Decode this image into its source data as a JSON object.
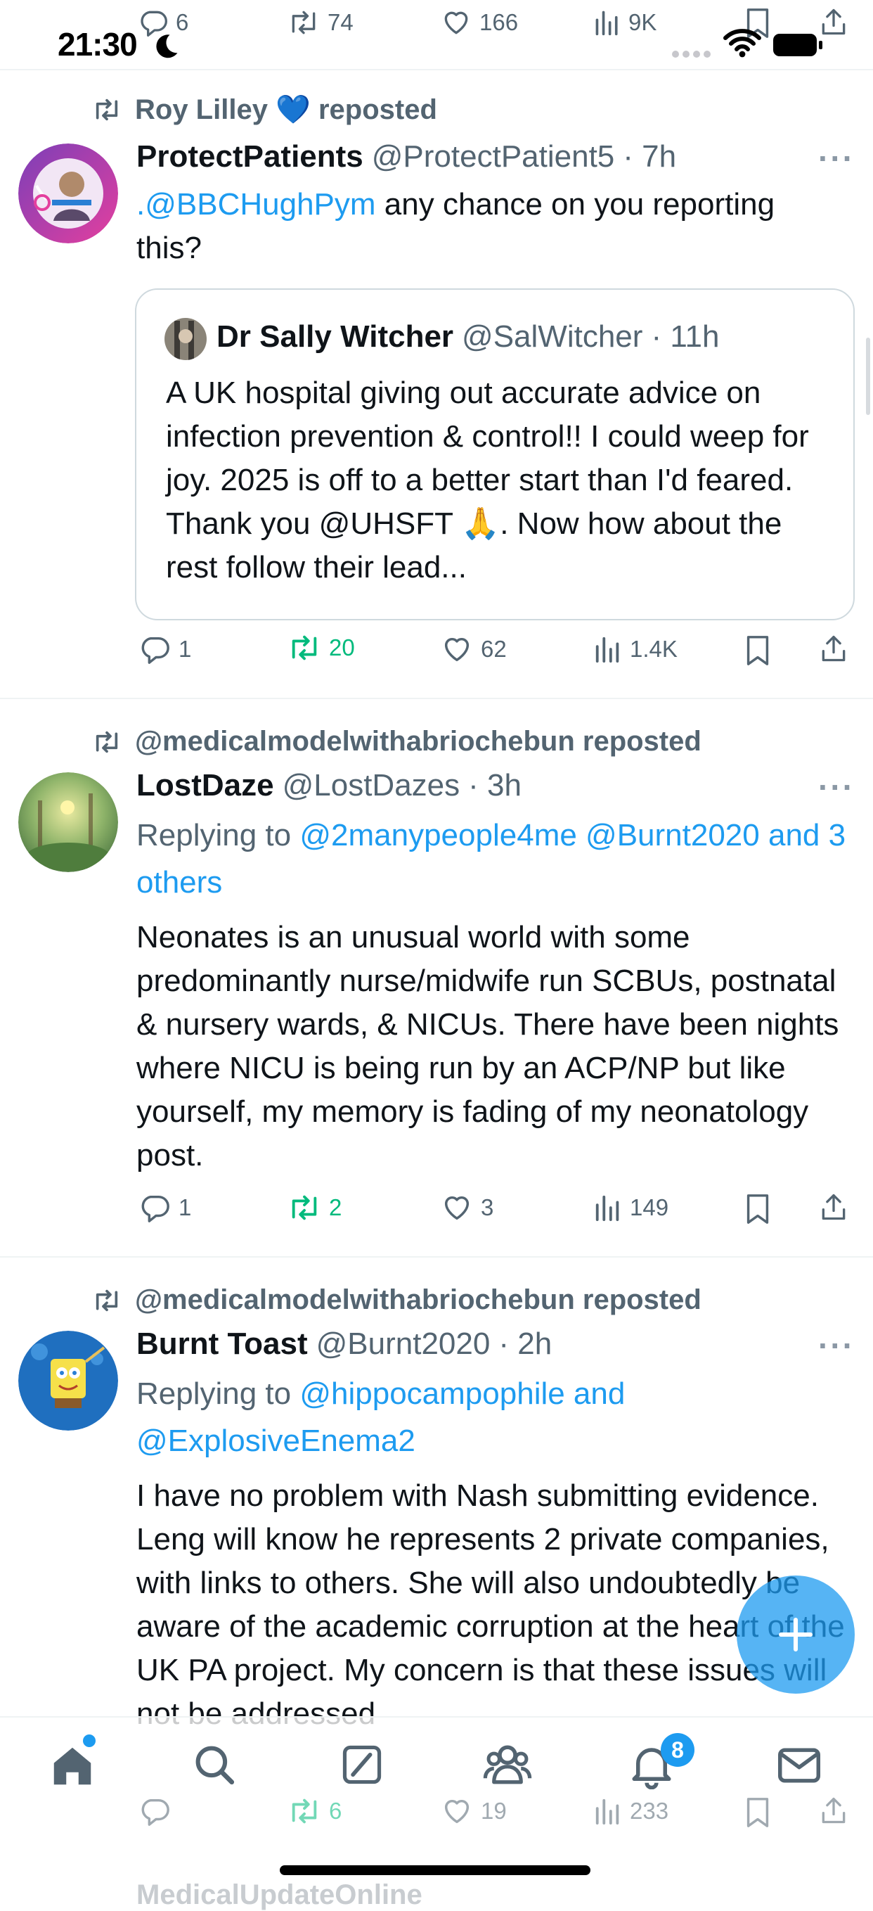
{
  "status_bar": {
    "time": "21:30"
  },
  "top_tweet_stats": {
    "replies": "6",
    "reposts": "74",
    "likes": "166",
    "views": "9K"
  },
  "tweets": [
    {
      "repost_by": "Roy Lilley 💙 reposted",
      "name": "ProtectPatients",
      "handle": "@ProtectPatient5",
      "time": "· 7h",
      "text_mention": ".@BBCHughPym",
      "text": " any chance on you reporting this?",
      "quote": {
        "name": "Dr Sally Witcher",
        "handle": "@SalWitcher",
        "time": "· 11h",
        "text": "A UK hospital giving out accurate advice on infection prevention & control!! I could weep for joy. 2025 is off to a better start than I'd feared. Thank you @UHSFT 🙏. Now how about the rest follow their lead..."
      },
      "stats": {
        "replies": "1",
        "reposts": "20",
        "likes": "62",
        "views": "1.4K"
      }
    },
    {
      "repost_by": "@medicalmodelwithabriochebun reposted",
      "name": "LostDaze",
      "handle": "@LostDazes",
      "time": "· 3h",
      "replying_prefix": "Replying to ",
      "replying_to": "@2manypeople4me @Burnt2020 and 3 others",
      "text": "Neonates is an unusual world with some predominantly nurse/midwife run SCBUs, postnatal & nursery wards, & NICUs. There have been nights where NICU is being run by an ACP/NP but like yourself, my memory is fading of my neonatology post.",
      "stats": {
        "replies": "1",
        "reposts": "2",
        "likes": "3",
        "views": "149"
      }
    },
    {
      "repost_by": "@medicalmodelwithabriochebun reposted",
      "name": "Burnt Toast",
      "handle": "@Burnt2020",
      "time": "· 2h",
      "replying_prefix": "Replying to ",
      "replying_to": "@hippocampophile and @ExplosiveEnema2",
      "text": "I have no problem with Nash submitting evidence. Leng will know he represents 2 private companies, with links to others. She will also undoubtedly be aware of the academic corruption at the heart of the UK PA project. My concern is that these issues will not be addressed",
      "stats": {
        "replies": "",
        "reposts": "6",
        "likes": "19",
        "views": "233"
      }
    }
  ],
  "next_tweet_partial": "MedicalUpdateOnline",
  "tab_bar": {
    "notifications_badge": "8"
  },
  "colors": {
    "accent": "#1d9bf0",
    "repost_green": "#00ba7c",
    "muted": "#536471"
  },
  "icons": [
    "reply-icon",
    "repost-icon",
    "like-icon",
    "views-icon",
    "bookmark-icon",
    "share-icon",
    "home-icon",
    "search-icon",
    "grok-icon",
    "communities-icon",
    "notifications-icon",
    "messages-icon",
    "compose-plus-icon"
  ]
}
